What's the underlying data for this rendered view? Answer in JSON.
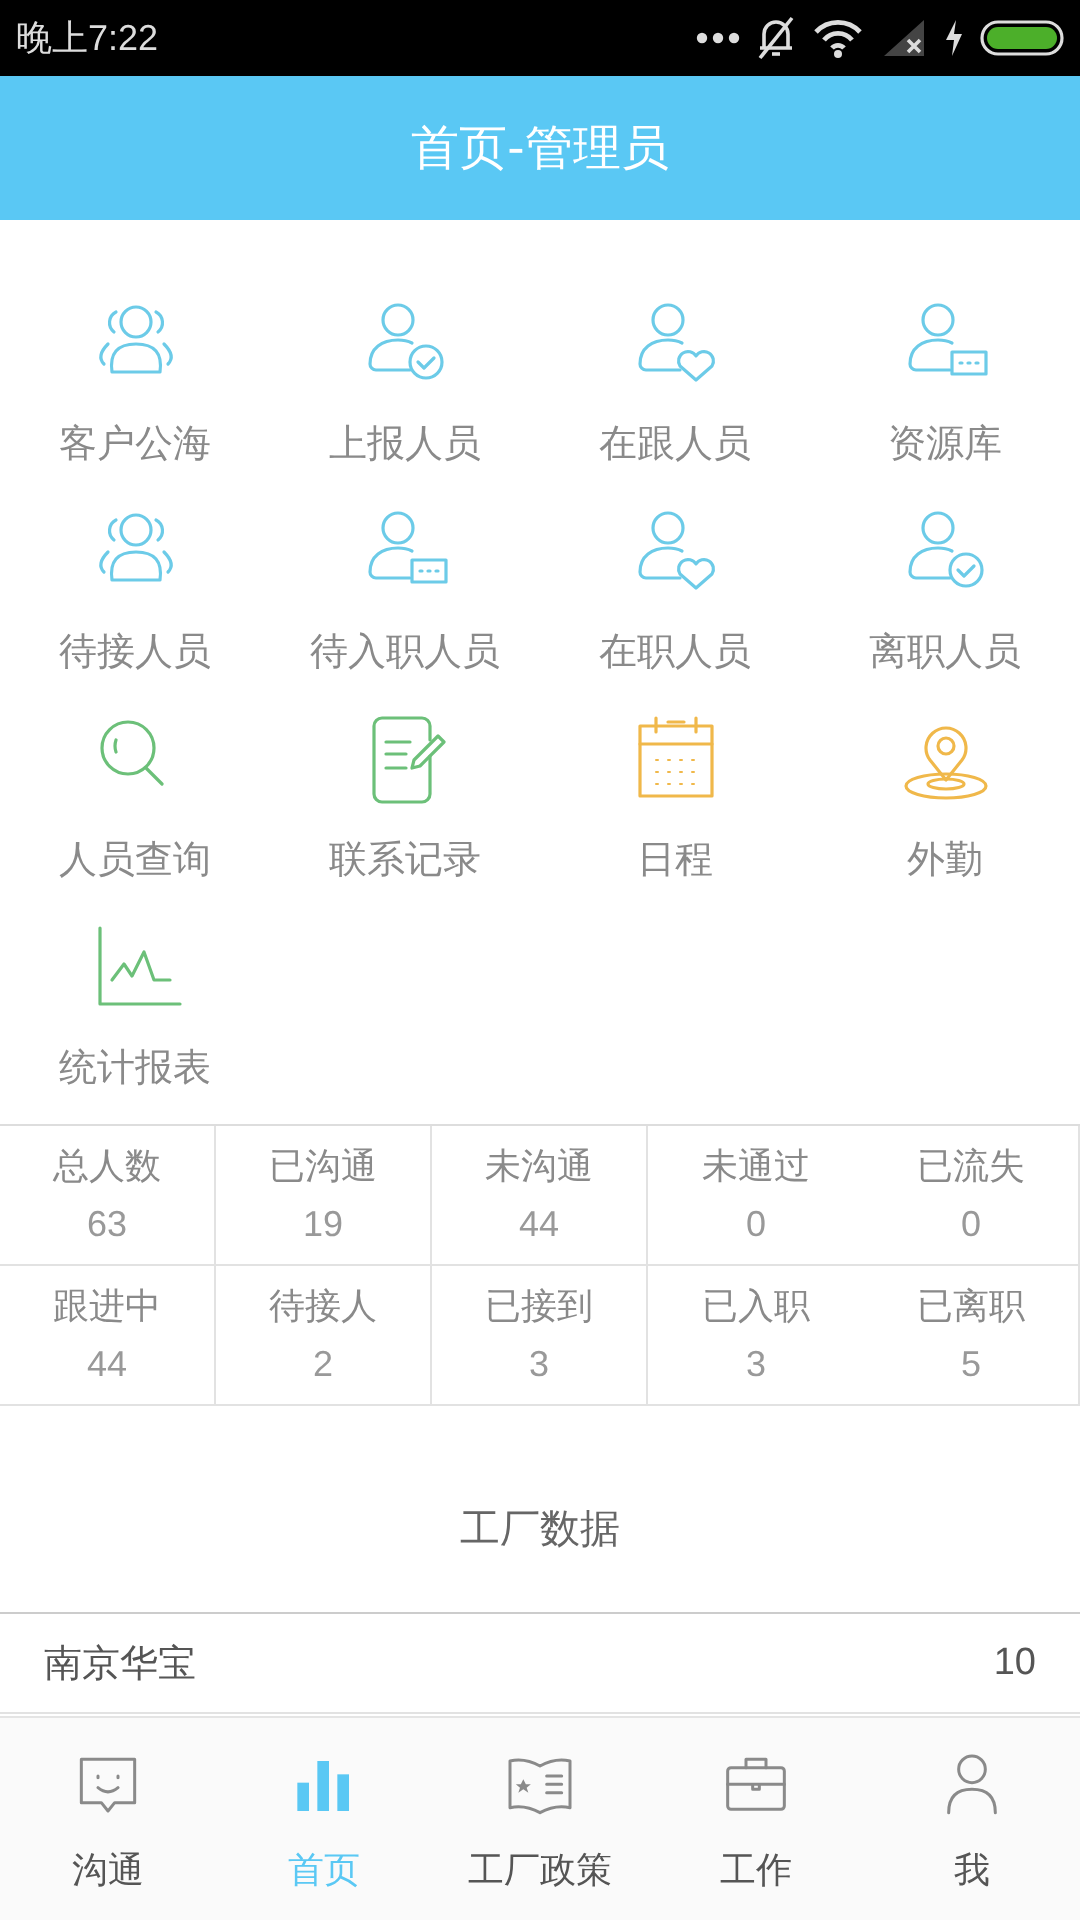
{
  "status_bar": {
    "time": "晚上7:22"
  },
  "header": {
    "title": "首页-管理员"
  },
  "features": [
    {
      "label": "客户公海",
      "kind": "group"
    },
    {
      "label": "上报人员",
      "kind": "user-check"
    },
    {
      "label": "在跟人员",
      "kind": "user-heart"
    },
    {
      "label": "资源库",
      "kind": "user-card"
    },
    {
      "label": "待接人员",
      "kind": "group"
    },
    {
      "label": "待入职人员",
      "kind": "user-card"
    },
    {
      "label": "在职人员",
      "kind": "user-heart"
    },
    {
      "label": "离职人员",
      "kind": "user-check"
    },
    {
      "label": "人员查询",
      "kind": "search"
    },
    {
      "label": "联系记录",
      "kind": "note"
    },
    {
      "label": "日程",
      "kind": "calendar"
    },
    {
      "label": "外勤",
      "kind": "location"
    },
    {
      "label": "统计报表",
      "kind": "chart"
    }
  ],
  "stats": [
    {
      "label": "总人数",
      "value": "63"
    },
    {
      "label": "已沟通",
      "value": "19"
    },
    {
      "label": "未沟通",
      "value": "44"
    },
    {
      "label": "未通过",
      "value": "0"
    },
    {
      "label": "已流失",
      "value": "0"
    },
    {
      "label": "跟进中",
      "value": "44"
    },
    {
      "label": "待接人",
      "value": "2"
    },
    {
      "label": "已接到",
      "value": "3"
    },
    {
      "label": "已入职",
      "value": "3"
    },
    {
      "label": "已离职",
      "value": "5"
    }
  ],
  "factory": {
    "title": "工厂数据",
    "rows": [
      {
        "name": "南京华宝",
        "count": "10"
      }
    ]
  },
  "tab_bar": [
    {
      "label": "沟通",
      "kind": "chat",
      "selected": false
    },
    {
      "label": "首页",
      "kind": "bars",
      "selected": true
    },
    {
      "label": "工厂政策",
      "kind": "book",
      "selected": false
    },
    {
      "label": "工作",
      "kind": "briefcase",
      "selected": false
    },
    {
      "label": "我",
      "kind": "person",
      "selected": false
    }
  ]
}
